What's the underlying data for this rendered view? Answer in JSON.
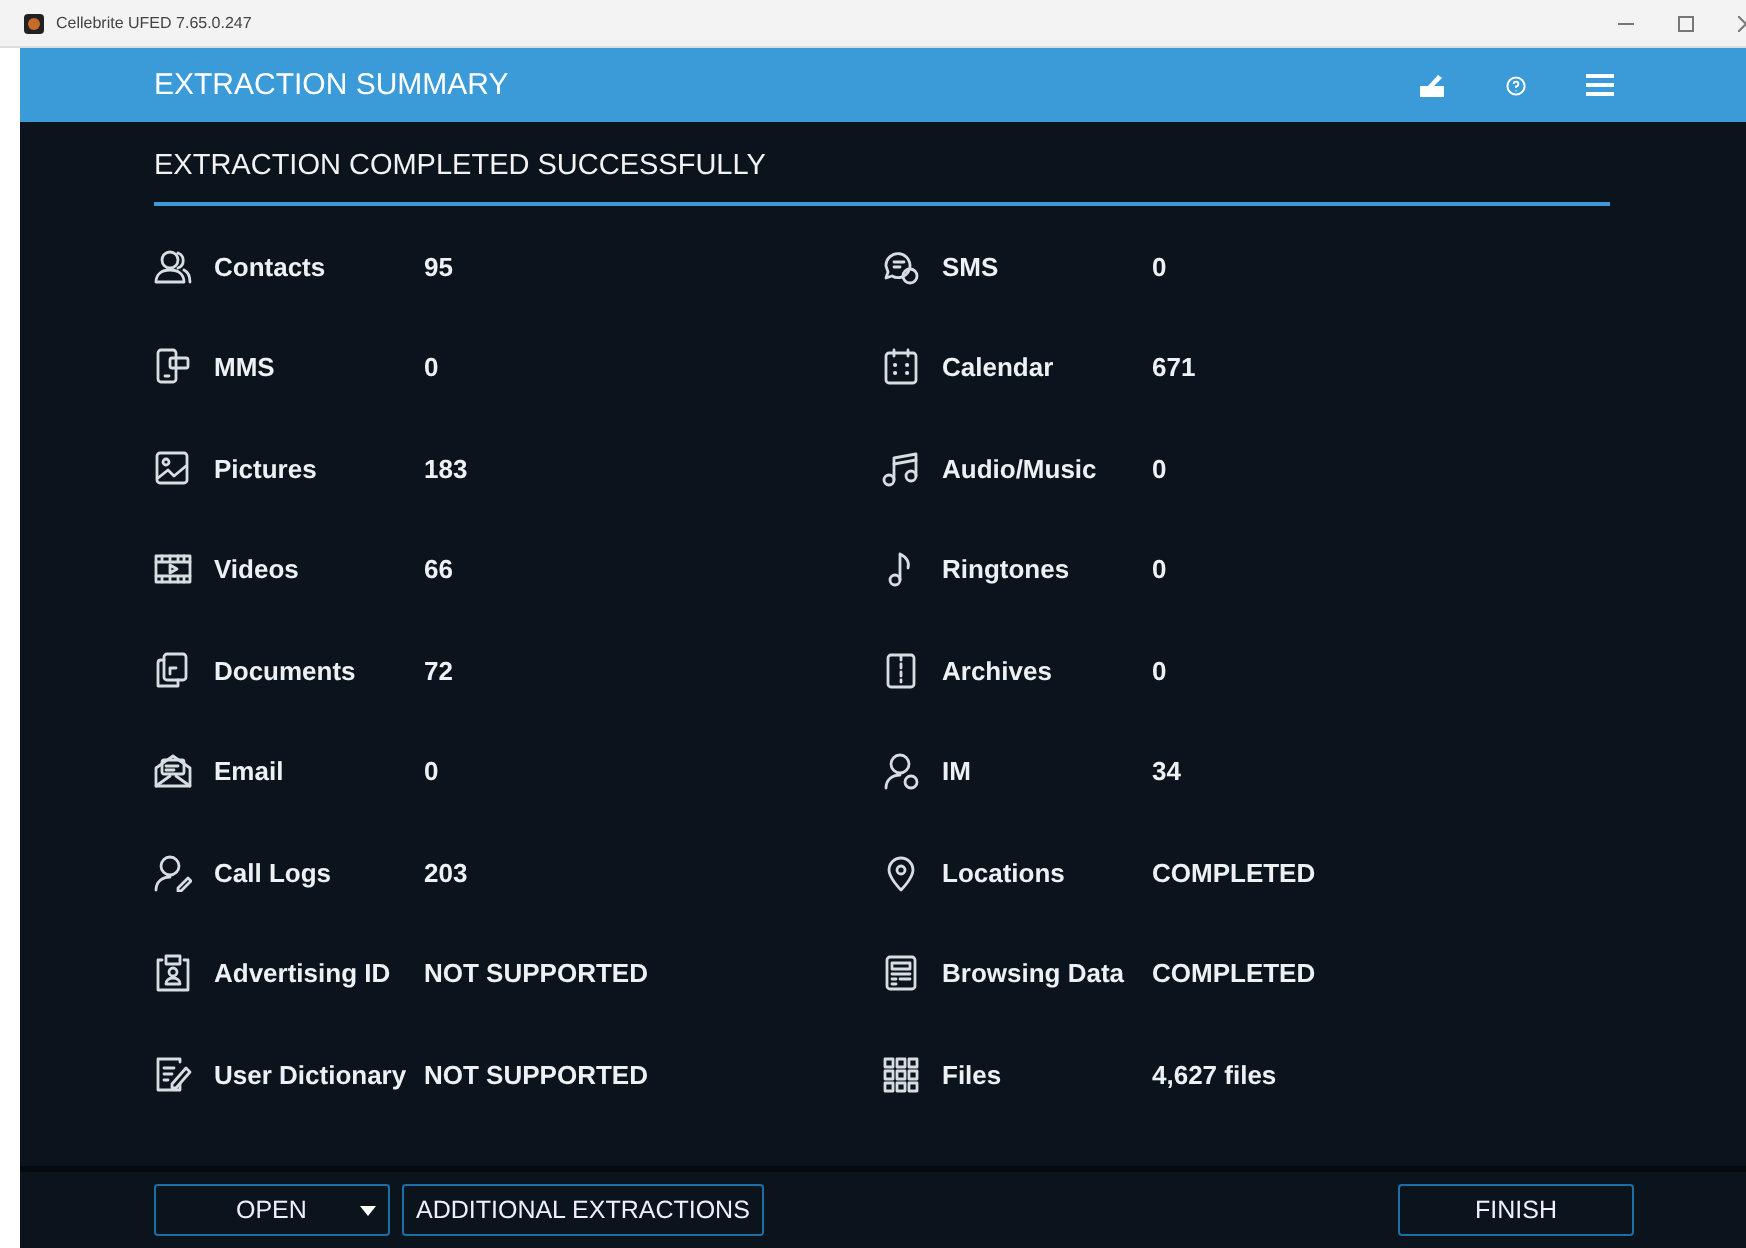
{
  "window": {
    "title": "Cellebrite UFED 7.65.0.247"
  },
  "header": {
    "title": "EXTRACTION SUMMARY"
  },
  "status": {
    "title": "EXTRACTION COMPLETED SUCCESSFULLY"
  },
  "summary": {
    "left": [
      {
        "label": "Contacts",
        "value": "95"
      },
      {
        "label": "MMS",
        "value": "0"
      },
      {
        "label": "Pictures",
        "value": "183"
      },
      {
        "label": "Videos",
        "value": "66"
      },
      {
        "label": "Documents",
        "value": "72"
      },
      {
        "label": "Email",
        "value": "0"
      },
      {
        "label": "Call Logs",
        "value": "203"
      },
      {
        "label": "Advertising ID",
        "value": "NOT SUPPORTED"
      },
      {
        "label": "User Dictionary",
        "value": "NOT SUPPORTED"
      }
    ],
    "right": [
      {
        "label": "SMS",
        "value": "0"
      },
      {
        "label": "Calendar",
        "value": "671"
      },
      {
        "label": "Audio/Music",
        "value": "0"
      },
      {
        "label": "Ringtones",
        "value": "0"
      },
      {
        "label": "Archives",
        "value": "0"
      },
      {
        "label": "IM",
        "value": "34"
      },
      {
        "label": "Locations",
        "value": "COMPLETED"
      },
      {
        "label": "Browsing Data",
        "value": "COMPLETED"
      },
      {
        "label": "Files",
        "value": "4,627 files"
      }
    ]
  },
  "footer": {
    "buttons": [
      {
        "label": "OPEN",
        "kind": "dropdown"
      },
      {
        "label": "ADDITIONAL EXTRACTIONS",
        "kind": "plain"
      },
      {
        "label": "FINISH",
        "kind": "plain"
      }
    ]
  }
}
